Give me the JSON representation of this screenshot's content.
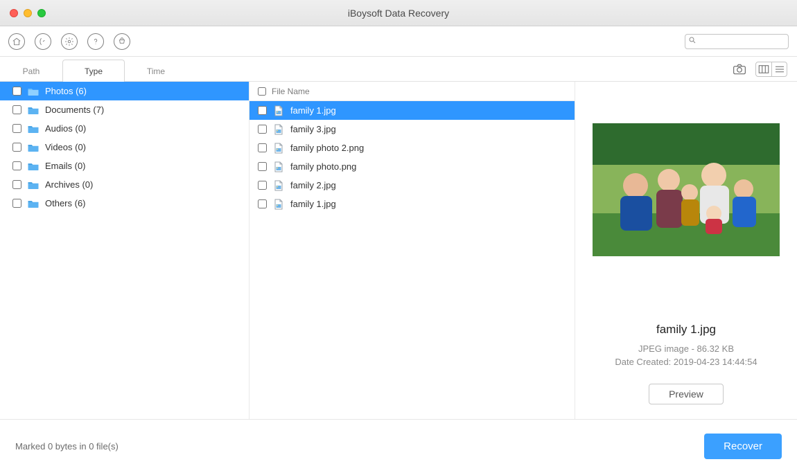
{
  "window": {
    "title": "iBoysoft Data Recovery"
  },
  "toolbar": {
    "icons": {
      "home": "home-icon",
      "scan": "scan-icon",
      "settings": "gear-icon",
      "help": "help-icon",
      "cart": "cart-icon"
    },
    "search": {
      "placeholder": ""
    }
  },
  "tabs": {
    "path": "Path",
    "type": "Type",
    "time": "Time",
    "active": "type"
  },
  "view_controls": {
    "camera": "camera-icon",
    "columns": "columns-icon",
    "list": "list-icon"
  },
  "sidebar": {
    "items": [
      {
        "name": "Photos",
        "count": 6
      },
      {
        "name": "Documents",
        "count": 7
      },
      {
        "name": "Audios",
        "count": 0
      },
      {
        "name": "Videos",
        "count": 0
      },
      {
        "name": "Emails",
        "count": 0
      },
      {
        "name": "Archives",
        "count": 0
      },
      {
        "name": "Others",
        "count": 6
      }
    ],
    "selected_index": 0
  },
  "filelist": {
    "header": "File Name",
    "items": [
      {
        "name": "family 1.jpg"
      },
      {
        "name": "family 3.jpg"
      },
      {
        "name": "family photo 2.png"
      },
      {
        "name": "family photo.png"
      },
      {
        "name": "family 2.jpg"
      },
      {
        "name": "family 1.jpg"
      }
    ],
    "selected_index": 0
  },
  "preview": {
    "filename": "family 1.jpg",
    "type_size": "JPEG image - 86.32 KB",
    "date_created": "Date Created: 2019-04-23 14:44:54",
    "button": "Preview"
  },
  "footer": {
    "status": "Marked 0 bytes in 0 file(s)",
    "recover": "Recover"
  },
  "colors": {
    "accent": "#2f96ff",
    "recover": "#3ba0ff"
  }
}
